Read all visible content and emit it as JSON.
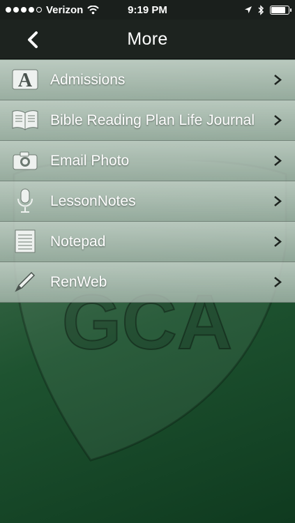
{
  "status_bar": {
    "carrier": "Verizon",
    "time": "9:19 PM",
    "signal_bars_filled": 4,
    "signal_bars_total": 5,
    "battery_level": 0.85
  },
  "nav": {
    "title": "More",
    "back_icon": "chevron-left-icon"
  },
  "menu": {
    "items": [
      {
        "label": "Admissions",
        "icon": "admissions-icon"
      },
      {
        "label": "Bible Reading Plan Life Journal",
        "icon": "book-icon"
      },
      {
        "label": "Email Photo",
        "icon": "camera-icon"
      },
      {
        "label": "LessonNotes",
        "icon": "microphone-icon"
      },
      {
        "label": "Notepad",
        "icon": "notepad-icon"
      },
      {
        "label": "RenWeb",
        "icon": "pencil-icon"
      }
    ]
  },
  "background": {
    "crest_text": "GCA"
  },
  "colors": {
    "bar_dark": "#1d231f",
    "row_bg": "#c3cfc7",
    "bg_green_dark": "#0f3a1f"
  }
}
